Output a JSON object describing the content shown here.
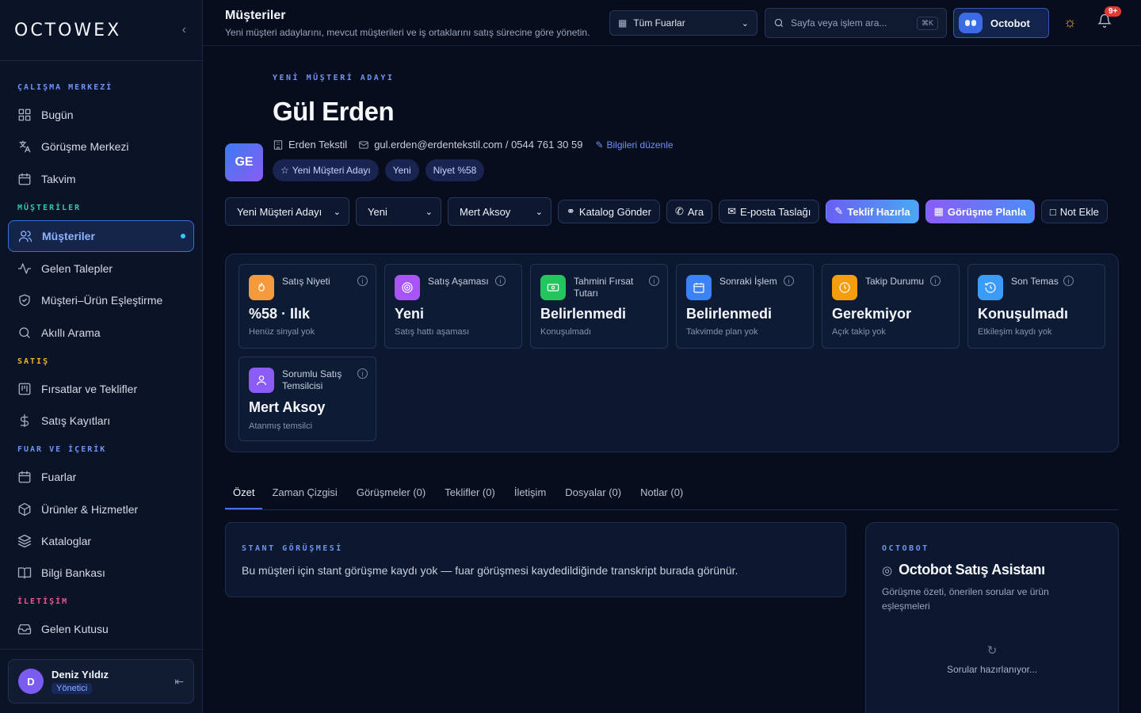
{
  "brand": {
    "logo": "OCTOWEX"
  },
  "sidebar": {
    "sections": [
      {
        "label": "ÇALIŞMA MERKEZİ",
        "color": "#6d93f5"
      },
      {
        "label": "MÜŞTERİLER",
        "color": "#38c2b0"
      },
      {
        "label": "SATIŞ",
        "color": "#f0b429"
      },
      {
        "label": "FUAR VE İÇERİK",
        "color": "#6d93f5"
      },
      {
        "label": "İLETİŞİM",
        "color": "#e35b8f"
      }
    ],
    "items": [
      {
        "label": "Bugün",
        "icon": "grid-icon"
      },
      {
        "label": "Görüşme Merkezi",
        "icon": "translate-icon"
      },
      {
        "label": "Takvim",
        "icon": "calendar-icon"
      },
      {
        "label": "Müşteriler",
        "icon": "users-icon"
      },
      {
        "label": "Gelen Talepler",
        "icon": "activity-icon"
      },
      {
        "label": "Müşteri–Ürün Eşleştirme",
        "icon": "shield-icon"
      },
      {
        "label": "Akıllı Arama",
        "icon": "search-icon"
      },
      {
        "label": "Fırsatlar ve Teklifler",
        "icon": "kanban-icon"
      },
      {
        "label": "Satış Kayıtları",
        "icon": "dollar-icon"
      },
      {
        "label": "Fuarlar",
        "icon": "calendar-icon"
      },
      {
        "label": "Ürünler & Hizmetler",
        "icon": "box-icon"
      },
      {
        "label": "Kataloglar",
        "icon": "layers-icon"
      },
      {
        "label": "Bilgi Bankası",
        "icon": "book-icon"
      },
      {
        "label": "Gelen Kutusu",
        "icon": "inbox-icon"
      }
    ],
    "user": {
      "initial": "D",
      "name": "Deniz Yıldız",
      "role": "Yönetici"
    }
  },
  "topbar": {
    "title": "Müşteriler",
    "subtitle": "Yeni müşteri adaylarını, mevcut müşterileri ve iş ortaklarını satış sürecine göre yönetin.",
    "fair_select": "Tüm Fuarlar",
    "search_placeholder": "Sayfa veya işlem ara...",
    "search_shortcut": "⌘K",
    "octobot": "Octobot",
    "notif_badge": "9+"
  },
  "customer": {
    "eyebrow": "YENİ MÜŞTERİ ADAYI",
    "name": "Gül Erden",
    "initials": "GE",
    "company": "Erden Tekstil",
    "contact": "gul.erden@erdentekstil.com / 0544 761 30 59",
    "edit": "Bilgileri düzenle",
    "chips": [
      "Yeni Müşteri Adayı",
      "Yeni",
      "Niyet %58"
    ]
  },
  "actions": {
    "selects": [
      "Yeni Müşteri Adayı",
      "Yeni",
      "Mert Aksoy"
    ],
    "buttons": [
      "Katalog Gönder",
      "Ara",
      "E-posta Taslağı",
      "Teklif Hazırla",
      "Görüşme Planla",
      "Not Ekle"
    ]
  },
  "kpis": [
    {
      "label": "Satış Niyeti",
      "value": "%58 · Ilık",
      "sub": "Henüz sinyal yok",
      "color": "#f59a3c"
    },
    {
      "label": "Satış Aşaması",
      "value": "Yeni",
      "sub": "Satış hattı aşaması",
      "color": "#a855f7"
    },
    {
      "label": "Tahmini Fırsat Tutarı",
      "value": "Belirlenmedi",
      "sub": "Konuşulmadı",
      "color": "#22c55e"
    },
    {
      "label": "Sonraki İşlem",
      "value": "Belirlenmedi",
      "sub": "Takvimde plan yok",
      "color": "#3b82f6"
    },
    {
      "label": "Takip Durumu",
      "value": "Gerekmiyor",
      "sub": "Açık takip yok",
      "color": "#f59e0b"
    },
    {
      "label": "Son Temas",
      "value": "Konuşulmadı",
      "sub": "Etkileşim kaydı yok",
      "color": "#3b9bf6"
    },
    {
      "label": "Sorumlu Satış Temsilcisi",
      "value": "Mert Aksoy",
      "sub": "Atanmış temsilci",
      "color": "#8b5cf6"
    }
  ],
  "tabs": [
    "Özet",
    "Zaman Çizgisi",
    "Görüşmeler (0)",
    "Teklifler (0)",
    "İletişim",
    "Dosyalar (0)",
    "Notlar (0)"
  ],
  "booth": {
    "eyebrow": "STANT GÖRÜŞMESİ",
    "text": "Bu müşteri için stant görüşme kaydı yok — fuar görüşmesi kaydedildiğinde transkript burada görünür."
  },
  "assistant": {
    "eyebrow": "OCTOBOT",
    "title": "Octobot Satış Asistanı",
    "desc": "Görüşme özeti, önerilen sorular ve ürün eşleşmeleri",
    "loading": "Sorular hazırlanıyor..."
  }
}
